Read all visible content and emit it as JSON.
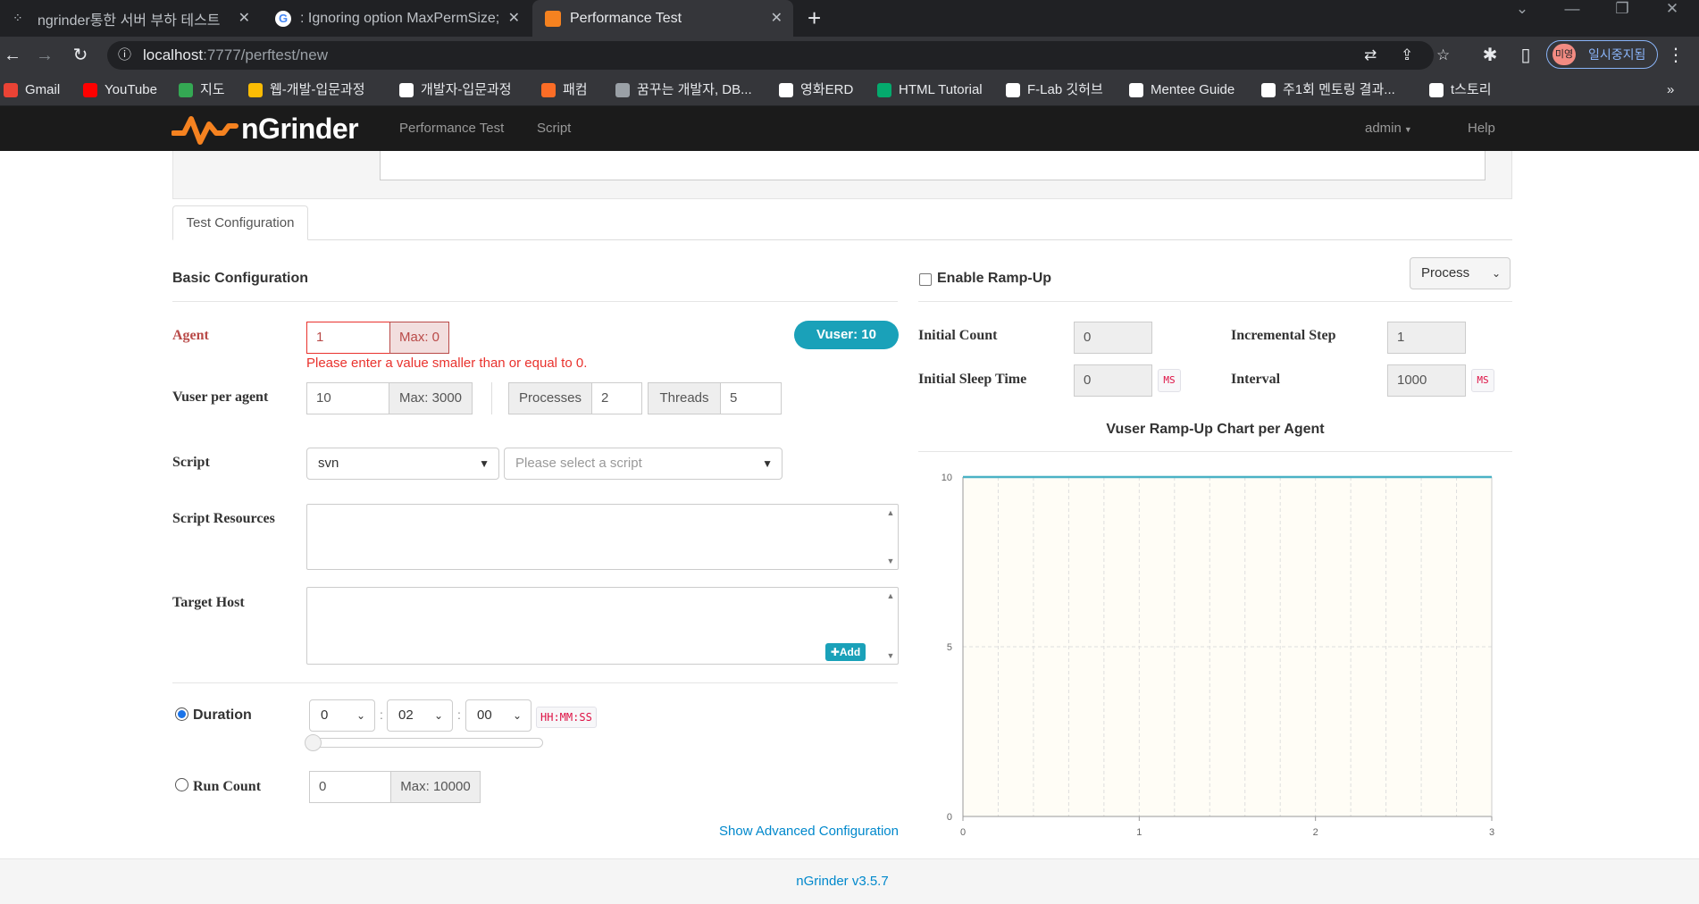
{
  "browser": {
    "tabs": [
      {
        "title": "ngrinder통한 서버 부하 테스트"
      },
      {
        "title": ": Ignoring option MaxPermSize;"
      },
      {
        "title": "Performance Test"
      }
    ],
    "new_tab": "+",
    "url_host": "localhost",
    "url_path": ":7777/perftest/new",
    "profile_initials": "미영",
    "profile_status": "일시중지됨",
    "bookmarks": [
      {
        "label": "Gmail",
        "color": "#ea4335"
      },
      {
        "label": "YouTube",
        "color": "#ff0000"
      },
      {
        "label": "지도",
        "color": "#34a853"
      },
      {
        "label": "웹-개발-입문과정",
        "color": "#fbbc04"
      },
      {
        "label": "개발자-입문과정",
        "color": "#ffffff"
      },
      {
        "label": "패컴",
        "color": "#fc6d26"
      },
      {
        "label": "꿈꾸는 개발자, DB...",
        "color": "#9aa0a6"
      },
      {
        "label": "영화ERD",
        "color": "#ffffff"
      },
      {
        "label": "HTML Tutorial",
        "color": "#04aa6d"
      },
      {
        "label": "F-Lab 깃허브",
        "color": "#ffffff"
      },
      {
        "label": "Mentee Guide",
        "color": "#ffffff"
      },
      {
        "label": "주1회 멘토링 결과...",
        "color": "#ffffff"
      },
      {
        "label": "t스토리",
        "color": "#ffffff"
      }
    ],
    "more_bookmarks": "»"
  },
  "nav": {
    "brand": "nGrinder",
    "links": [
      "Performance Test",
      "Script"
    ],
    "user": "admin",
    "help": "Help"
  },
  "tabs": {
    "active": "Test Configuration"
  },
  "basic": {
    "heading": "Basic Configuration",
    "agent_label": "Agent",
    "agent_value": "1",
    "agent_max": "Max: 0",
    "agent_error": "Please enter a value smaller than or equal to 0.",
    "vuser_badge": "Vuser: 10",
    "vuser_label": "Vuser per agent",
    "vuser_value": "10",
    "vuser_max": "Max: 3000",
    "processes_label": "Processes",
    "processes_value": "2",
    "threads_label": "Threads",
    "threads_value": "5",
    "script_label": "Script",
    "script_repo": "svn",
    "script_placeholder": "Please select a script",
    "resources_label": "Script Resources",
    "target_label": "Target Host",
    "add_button": "Add",
    "duration_label": "Duration",
    "duration_h": "0",
    "duration_m": "02",
    "duration_s": "00",
    "duration_format": "HH:MM:SS",
    "duration_selected": true,
    "runcount_label": "Run Count",
    "runcount_value": "0",
    "runcount_max": "Max: 10000",
    "advanced_link": "Show Advanced Configuration"
  },
  "rampup": {
    "enable_label": "Enable Ramp-Up",
    "enabled": false,
    "type": "Process",
    "initial_count_label": "Initial Count",
    "initial_count": "0",
    "incremental_step_label": "Incremental Step",
    "incremental_step": "1",
    "initial_sleep_label": "Initial Sleep Time",
    "initial_sleep": "0",
    "interval_label": "Interval",
    "interval": "1000",
    "ms_unit": "MS"
  },
  "chart_data": {
    "type": "line",
    "title": "Vuser Ramp-Up Chart per Agent",
    "x": [
      0,
      3
    ],
    "series": [
      {
        "values": [
          10,
          10
        ],
        "color": "#4bb2c5"
      }
    ],
    "xlim": [
      0,
      3
    ],
    "ylim": [
      0,
      10
    ],
    "x_ticks": [
      "0",
      "1",
      "2",
      "3"
    ],
    "y_ticks": [
      "0",
      "5",
      "10"
    ],
    "grid": true,
    "background": "#fffdf6"
  },
  "footer": {
    "version": "nGrinder v3.5.7"
  }
}
